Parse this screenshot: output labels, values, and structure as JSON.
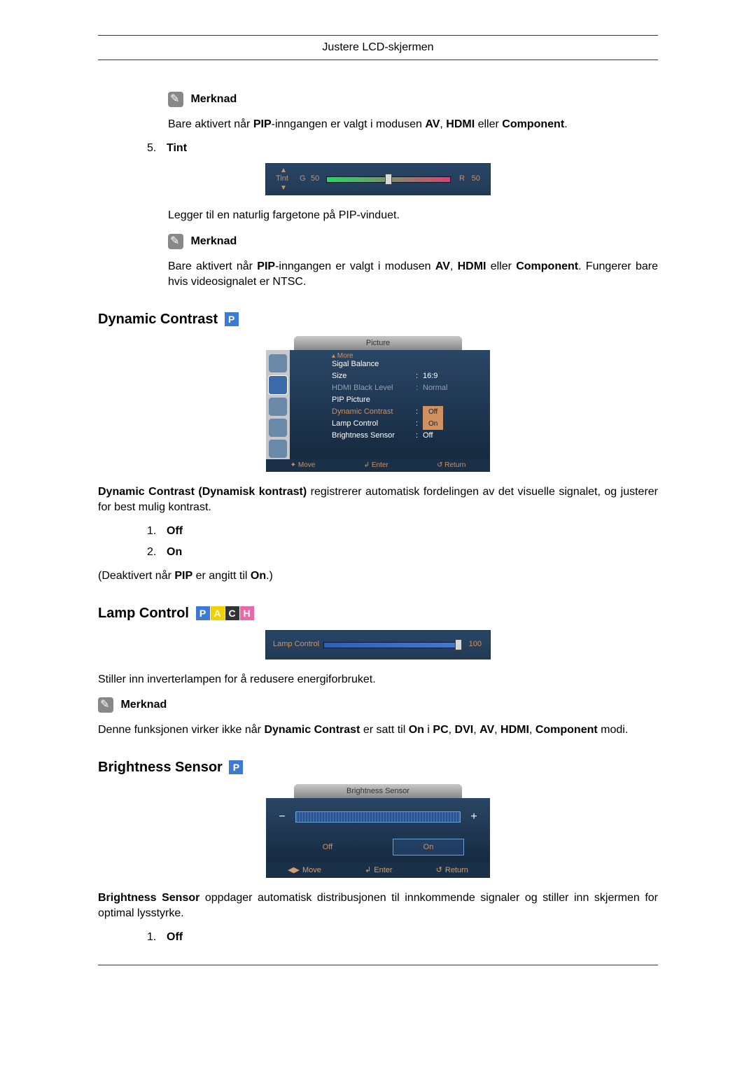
{
  "header": {
    "title": "Justere LCD-skjermen"
  },
  "note_label": "Merknad",
  "notes": {
    "n1": {
      "pre": "Bare aktivert når ",
      "b1": "PIP",
      "mid1": "-inngangen er valgt i modusen ",
      "b2": "AV",
      "sep1": ", ",
      "b3": "HDMI",
      "mid2": " eller ",
      "b4": "Component",
      "post": "."
    },
    "n2": {
      "pre": "Bare aktivert når ",
      "b1": "PIP",
      "mid1": "-inngangen er valgt i modusen ",
      "b2": "AV",
      "sep1": ", ",
      "b3": "HDMI",
      "mid2": " eller ",
      "b4": "Component",
      "post": ". Fungerer bare hvis videosignalet er NTSC."
    }
  },
  "tint": {
    "list_num": "5.",
    "title": "Tint",
    "desc": "Legger til en naturlig fargetone på PIP-vinduet.",
    "widget": {
      "label": "Tint",
      "g": "G",
      "gval": "50",
      "r": "R",
      "rval": "50"
    }
  },
  "dynamic_contrast": {
    "heading": "Dynamic Contrast",
    "badges": [
      "P"
    ],
    "menu": {
      "tab": "Picture",
      "more": "▴ More",
      "rows": [
        {
          "k": "Sigal Balance",
          "v": ""
        },
        {
          "k": "Size",
          "v": "16:9"
        },
        {
          "k": "HDMI Black Level",
          "v": "Normal"
        },
        {
          "k": "PIP Picture",
          "v": ""
        },
        {
          "k": "Dynamic Contrast",
          "v": "Off"
        },
        {
          "k": "Lamp Control",
          "v": "On"
        },
        {
          "k": "Brightness Sensor",
          "v": "Off"
        }
      ],
      "footer": {
        "move": "Move",
        "enter": "Enter",
        "ret": "Return"
      }
    },
    "desc": {
      "b1": "Dynamic Contrast (Dynamisk kontrast)",
      "rest": " registrerer automatisk fordelingen av det visuelle signalet, og justerer for best mulig kontrast."
    },
    "opts": [
      {
        "n": "1.",
        "l": "Off"
      },
      {
        "n": "2.",
        "l": "On"
      }
    ],
    "note": {
      "pre": "(Deaktivert når ",
      "b1": "PIP",
      "mid": " er angitt til ",
      "b2": "On",
      "post": ".)"
    }
  },
  "lamp_control": {
    "heading": "Lamp Control",
    "badges": [
      "P",
      "A",
      "C",
      "H"
    ],
    "widget": {
      "label": "Lamp Control",
      "value": "100"
    },
    "desc": "Stiller inn inverterlampen for å redusere energiforbruket.",
    "note": {
      "pre": "Denne funksjonen virker ikke når ",
      "b1": "Dynamic Contrast",
      "mid1": " er satt til ",
      "b2": "On",
      "mid2": " i ",
      "b3": "PC",
      "s1": ", ",
      "b4": "DVI",
      "s2": ", ",
      "b5": "AV",
      "s3": ", ",
      "b6": "HDMI",
      "s4": ", ",
      "b7": "Component",
      "post": " modi."
    }
  },
  "brightness_sensor": {
    "heading": "Brightness Sensor",
    "badges": [
      "P"
    ],
    "widget": {
      "tab": "Brightness Sensor",
      "off": "Off",
      "on": "On",
      "footer": {
        "move": "Move",
        "enter": "Enter",
        "ret": "Return"
      }
    },
    "desc": {
      "b1": "Brightness Sensor",
      "rest": " oppdager automatisk distribusjonen til innkommende signaler og stiller inn skjermen for optimal lysstyrke."
    },
    "opts": [
      {
        "n": "1.",
        "l": "Off"
      }
    ]
  }
}
